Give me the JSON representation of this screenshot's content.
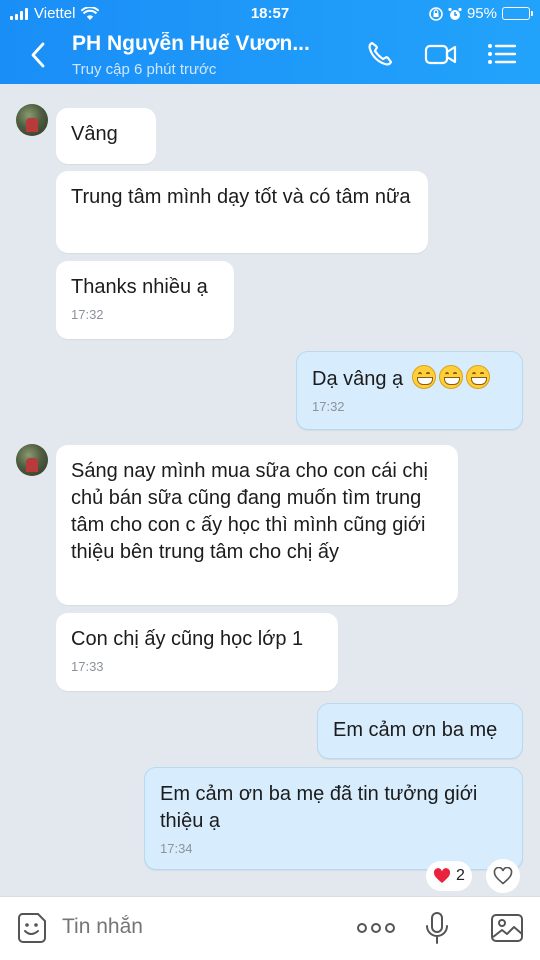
{
  "status": {
    "carrier": "Viettel",
    "time": "18:57",
    "battery": "95%",
    "battery_level": 0.95
  },
  "header": {
    "title": "PH Nguyễn Huế Vươn...",
    "subtitle": "Truy cập 6 phút trước"
  },
  "messages": [
    {
      "text": "Vâng"
    },
    {
      "text": "Trung tâm mình  dạy tốt và có tâm nữa"
    },
    {
      "text": "Thanks nhiều ạ",
      "time": "17:32"
    },
    {
      "text": "Dạ vâng ạ",
      "time": "17:32",
      "emoji": "grinning-face-x3"
    },
    {
      "text": " Sáng nay mình mua sữa cho con cái chị chủ bán sữa cũng đang muốn tìm trung tâm cho con c ấy học thì mình cũng giới thiệu bên trung tâm cho chị ấy"
    },
    {
      "text": "Con chị ấy cũng học lớp 1",
      "time": "17:33"
    },
    {
      "text": "Em cảm ơn ba mẹ"
    },
    {
      "text": "Em cảm ơn ba mẹ đã tin tưởng giới thiệu ạ",
      "time": "17:34"
    }
  ],
  "reaction": {
    "count": "2"
  },
  "input": {
    "placeholder": "Tin nhắn"
  },
  "colors": {
    "header": "#1a8ef7",
    "my_bubble": "#d7ecfc",
    "their_bubble": "#ffffff",
    "background": "#e3e8ef"
  }
}
